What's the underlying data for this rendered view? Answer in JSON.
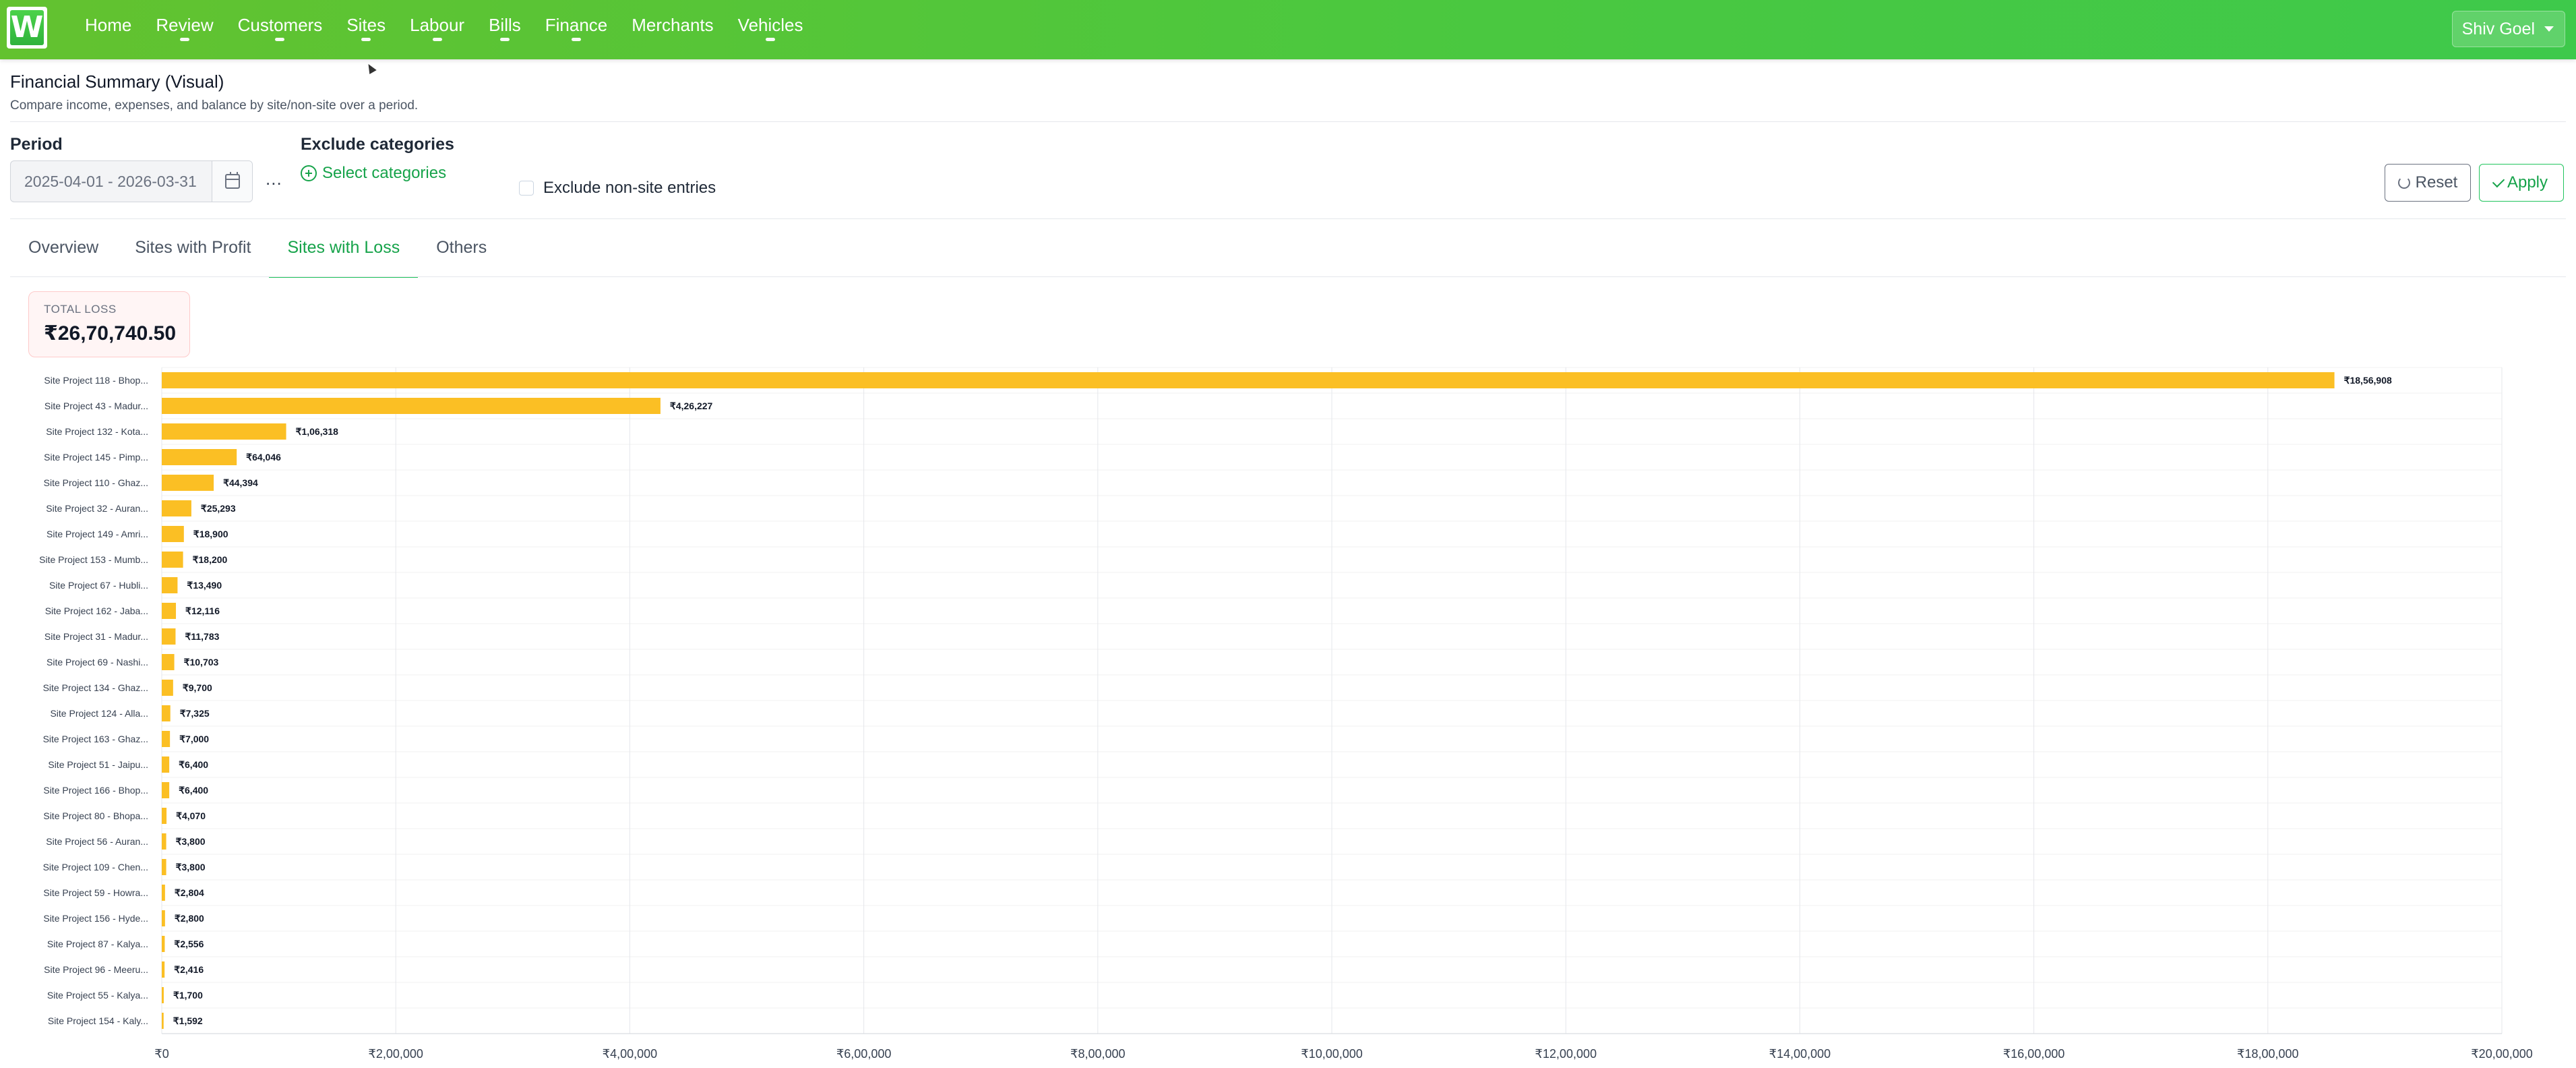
{
  "app": {
    "logo_letter": "W",
    "nav": [
      "Home",
      "Review",
      "Customers",
      "Sites",
      "Labour",
      "Bills",
      "Finance",
      "Merchants",
      "Vehicles"
    ],
    "nav_with_indicator": [
      false,
      true,
      true,
      true,
      true,
      true,
      true,
      false,
      true
    ],
    "user": "Shiv Goel"
  },
  "header": {
    "title": "Financial Summary (Visual)",
    "subtitle": "Compare income, expenses, and balance by site/non-site over a period."
  },
  "filters": {
    "period_label": "Period",
    "period_value": "2025-04-01 - 2026-03-31",
    "more": "...",
    "exclude_categories_label": "Exclude categories",
    "select_categories": "Select categories",
    "exclude_non_site": "Exclude non-site entries",
    "exclude_non_site_checked": false,
    "reset": "Reset",
    "apply": "Apply"
  },
  "tabs": [
    {
      "label": "Overview",
      "active": false
    },
    {
      "label": "Sites with Profit",
      "active": false
    },
    {
      "label": "Sites with Loss",
      "active": true
    },
    {
      "label": "Others",
      "active": false
    }
  ],
  "summary": {
    "label": "TOTAL LOSS",
    "value": "₹26,70,740.50"
  },
  "colors": {
    "bar": "#fbbf24",
    "accent": "#16a34a",
    "nav_start": "#63c22f",
    "nav_end": "#3ec94b"
  },
  "chart_data": {
    "type": "bar",
    "orientation": "horizontal",
    "categories": [
      "Site Project 118 - Bhop...",
      "Site Project 43 - Madur...",
      "Site Project 132 - Kota...",
      "Site Project 145 - Pimp...",
      "Site Project 110 - Ghaz...",
      "Site Project 32 - Auran...",
      "Site Project 149 - Amri...",
      "Site Project 153 - Mumb...",
      "Site Project 67 - Hubli...",
      "Site Project 162 - Jaba...",
      "Site Project 31 - Madur...",
      "Site Project 69 - Nashi...",
      "Site Project 134 - Ghaz...",
      "Site Project 124 - Alla...",
      "Site Project 163 - Ghaz...",
      "Site Project 51 - Jaipu...",
      "Site Project 166 - Bhop...",
      "Site Project 80 - Bhopa...",
      "Site Project 56 - Auran...",
      "Site Project 109 - Chen...",
      "Site Project 59 - Howra...",
      "Site Project 156 - Hyde...",
      "Site Project 87 - Kalya...",
      "Site Project 96 - Meeru...",
      "Site Project 55 - Kalya...",
      "Site Project 154 - Kaly..."
    ],
    "values": [
      1856908,
      426227,
      106318,
      64046,
      44394,
      25293,
      18900,
      18200,
      13490,
      12116,
      11783,
      10703,
      9700,
      7325,
      7000,
      6400,
      6400,
      4070,
      3800,
      3800,
      2804,
      2800,
      2556,
      2416,
      1700,
      1592
    ],
    "value_labels": [
      "₹18,56,908",
      "₹4,26,227",
      "₹1,06,318",
      "₹64,046",
      "₹44,394",
      "₹25,293",
      "₹18,900",
      "₹18,200",
      "₹13,490",
      "₹12,116",
      "₹11,783",
      "₹10,703",
      "₹9,700",
      "₹7,325",
      "₹7,000",
      "₹6,400",
      "₹6,400",
      "₹4,070",
      "₹3,800",
      "₹3,800",
      "₹2,804",
      "₹2,800",
      "₹2,556",
      "₹2,416",
      "₹1,700",
      "₹1,592"
    ],
    "xlim": [
      0,
      2000000
    ],
    "x_ticks": [
      0,
      200000,
      400000,
      600000,
      800000,
      1000000,
      1200000,
      1400000,
      1600000,
      1800000,
      2000000
    ],
    "x_tick_labels": [
      "₹0",
      "₹2,00,000",
      "₹4,00,000",
      "₹6,00,000",
      "₹8,00,000",
      "₹10,00,000",
      "₹12,00,000",
      "₹14,00,000",
      "₹16,00,000",
      "₹18,00,000",
      "₹20,00,000"
    ],
    "grid": true,
    "legend": "none"
  }
}
